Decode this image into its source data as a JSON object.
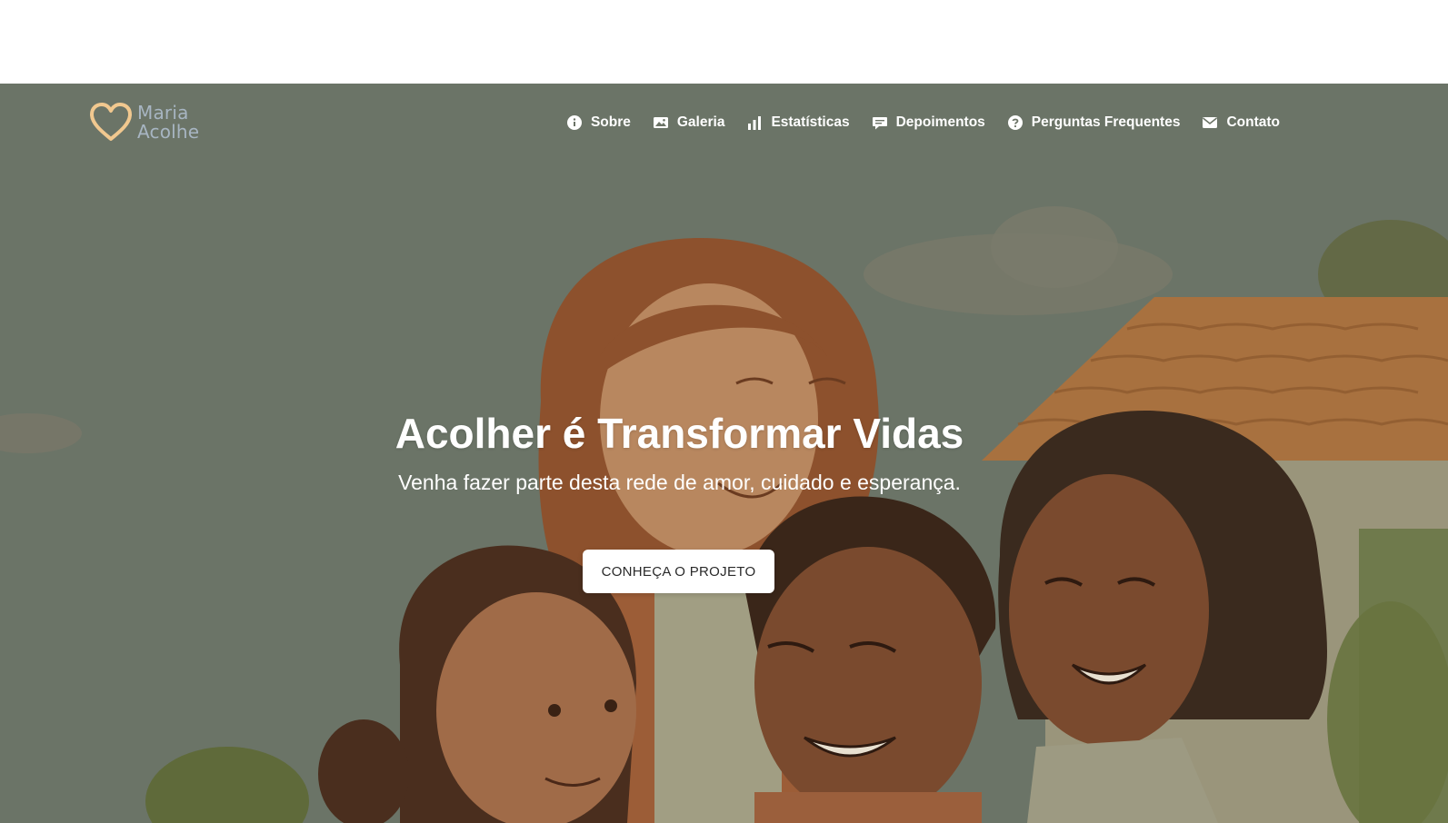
{
  "brand": {
    "name_line1": "Maria",
    "name_line2": "Acolhe",
    "heart_color": "#f1c88f",
    "text_color": "#a7b5c2"
  },
  "nav": {
    "items": [
      {
        "label": "Sobre",
        "icon": "info-circle-icon"
      },
      {
        "label": "Galeria",
        "icon": "image-icon"
      },
      {
        "label": "Estatísticas",
        "icon": "bar-chart-icon"
      },
      {
        "label": "Depoimentos",
        "icon": "comment-icon"
      },
      {
        "label": "Perguntas Frequentes",
        "icon": "question-circle-icon"
      },
      {
        "label": "Contato",
        "icon": "envelope-icon"
      }
    ]
  },
  "hero": {
    "title": "Acolher é Transformar Vidas",
    "subtitle": "Venha fazer parte desta rede de amor, cuidado e esperança.",
    "cta_label": "CONHEÇA O PROJETO"
  },
  "colors": {
    "overlay": "#6b7366",
    "nav_text": "#ffffff",
    "button_bg": "#ffffff",
    "button_text": "#2a2a2a"
  }
}
